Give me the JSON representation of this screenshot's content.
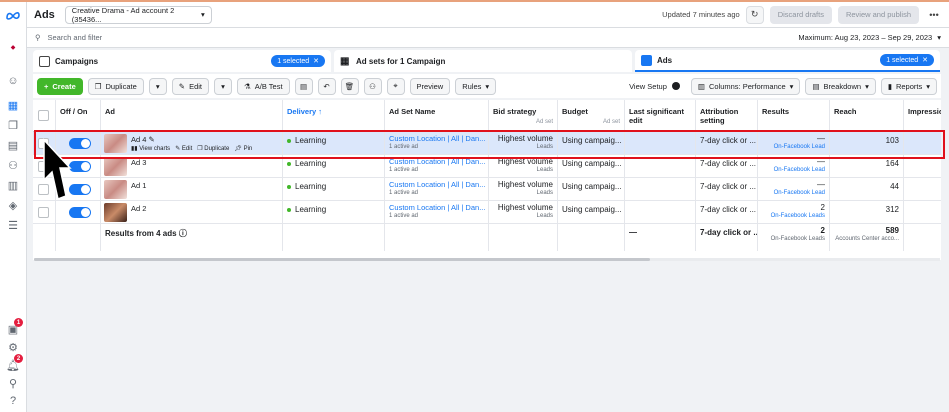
{
  "header": {
    "title": "Ads",
    "account": "Creative Drama - Ad account 2 (35436...",
    "updated": "Updated 7 minutes ago",
    "discard": "Discard drafts",
    "review": "Review and publish"
  },
  "search": {
    "placeholder": "Search and filter",
    "date_range": "Maximum: Aug 23, 2023 – Sep 29, 2023"
  },
  "tabs": {
    "campaigns": "Campaigns",
    "campaigns_selected": "1 selected",
    "adsets": "Ad sets for 1 Campaign",
    "ads": "Ads",
    "ads_selected": "1 selected"
  },
  "toolbar": {
    "create": "Create",
    "duplicate": "Duplicate",
    "edit": "Edit",
    "abtest": "A/B Test",
    "preview": "Preview",
    "rules": "Rules",
    "view_setup": "View Setup",
    "columns": "Columns: Performance",
    "breakdown": "Breakdown",
    "reports": "Reports"
  },
  "table": {
    "headers": {
      "off_on": "Off / On",
      "ad": "Ad",
      "delivery": "Delivery ↑",
      "ad_set_name": "Ad Set Name",
      "bid_strategy": "Bid strategy",
      "bid_sub": "Ad set",
      "budget": "Budget",
      "budget_sub": "Ad set",
      "last_edit": "Last significant edit",
      "attribution": "Attribution setting",
      "results": "Results",
      "reach": "Reach",
      "impressions": "Impression"
    },
    "rows": [
      {
        "ad": "Ad 4",
        "delivery": "Learning",
        "adset": "Custom Location | All | Dan...",
        "adset_sub": "1 active ad",
        "bid": "Highest volume",
        "bid_sub": "Leads",
        "budget": "Using campaig...",
        "attribution": "7-day click or ...",
        "results": "—",
        "results_sub": "On-Facebook Lead",
        "reach": "103"
      },
      {
        "ad": "Ad 3",
        "delivery": "Learning",
        "adset": "Custom Location | All | Dan...",
        "adset_sub": "1 active ad",
        "bid": "Highest volume",
        "bid_sub": "Leads",
        "budget": "Using campaig...",
        "attribution": "7-day click or ...",
        "results": "—",
        "results_sub": "On-Facebook Lead",
        "reach": "164"
      },
      {
        "ad": "Ad 1",
        "delivery": "Learning",
        "adset": "Custom Location | All | Dan...",
        "adset_sub": "1 active ad",
        "bid": "Highest volume",
        "bid_sub": "Leads",
        "budget": "Using campaig...",
        "attribution": "7-day click or ...",
        "results": "—",
        "results_sub": "On-Facebook Lead",
        "reach": "44"
      },
      {
        "ad": "Ad 2",
        "delivery": "Learning",
        "adset": "Custom Location | All | Dan...",
        "adset_sub": "1 active ad",
        "bid": "Highest volume",
        "bid_sub": "Leads",
        "budget": "Using campaig...",
        "attribution": "7-day click or ...",
        "results": "2",
        "results_sub": "On-Facebook Leads",
        "reach": "312"
      }
    ],
    "row_actions": {
      "view_charts": "View charts",
      "edit": "Edit",
      "duplicate": "Duplicate",
      "pin": "Pin"
    },
    "summary": {
      "label": "Results from 4 ads",
      "last_edit": "—",
      "attribution": "7-day click or ...",
      "results": "2",
      "results_sub": "On-Facebook Leads",
      "reach": "589",
      "reach_sub": "Accounts Center acco..."
    }
  },
  "rail": {
    "badge_1": "1",
    "badge_2": "2"
  },
  "colors": {
    "accent": "#1877f2",
    "create": "#42b72a",
    "highlight": "#e0111b"
  }
}
